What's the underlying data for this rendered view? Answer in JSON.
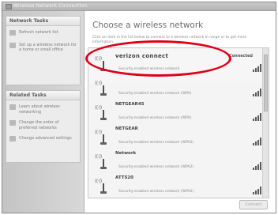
{
  "window": {
    "title": "Wireless Network Connection"
  },
  "sidebar": {
    "network_tasks": {
      "header": "Network Tasks",
      "items": [
        {
          "label": "Refresh network list"
        },
        {
          "label": "Set up a wireless network for a home or small office"
        }
      ]
    },
    "related_tasks": {
      "header": "Related Tasks",
      "items": [
        {
          "label": "Learn about wireless networking"
        },
        {
          "label": "Change the order of preferred networks"
        },
        {
          "label": "Change advanced settings"
        }
      ]
    }
  },
  "main": {
    "heading": "Choose a wireless network",
    "instructions": "Click an item in the list below to connect to a wireless network in range or to get more information.",
    "networks": [
      {
        "name": "verizon connect",
        "security": "Security-enabled wireless network",
        "status": "Connected",
        "signal": 4
      },
      {
        "name": "",
        "security": "Security-enabled wireless network (WPA)",
        "status": "",
        "signal": 4
      },
      {
        "name": "NETGEAR45",
        "security": "Security-enabled wireless network (WPA)",
        "status": "",
        "signal": 4
      },
      {
        "name": "NETGEAR",
        "security": "Security-enabled wireless network (WPA2)",
        "status": "",
        "signal": 4
      },
      {
        "name": "Network",
        "security": "Security-enabled wireless network (WPA2)",
        "status": "",
        "signal": 4
      },
      {
        "name": "ATT520",
        "security": "Security-enabled wireless network (WPA2)",
        "status": "",
        "signal": 4
      }
    ],
    "connect_button": "Connect"
  },
  "annotation": {
    "color": "#e0001b"
  }
}
